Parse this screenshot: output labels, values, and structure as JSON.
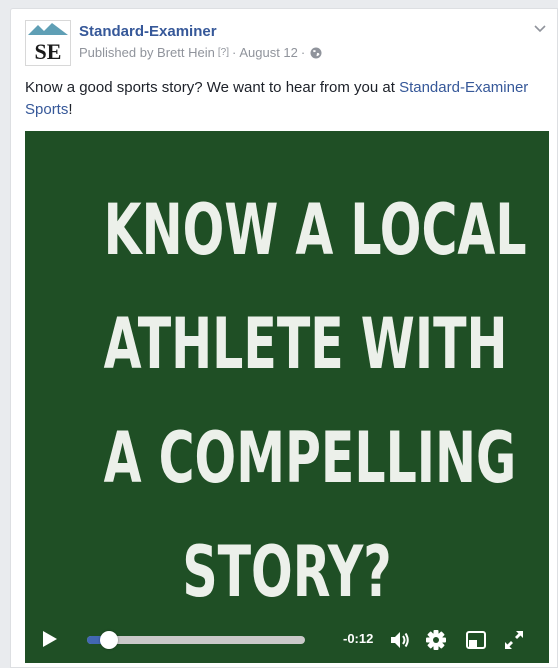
{
  "post": {
    "author": "Standard-Examiner",
    "avatar_text": "SE",
    "published_by": "Published by Brett Hein",
    "help_marker": "[?]",
    "separator": "·",
    "date": "August 12",
    "text_before_link": "Know a good sports story? We want to hear from you at ",
    "link_text": "Standard-Examiner Sports",
    "text_after_link": "!"
  },
  "video": {
    "background_color": "#1f4f25",
    "overlay_lines": [
      "KNOW A LOCAL",
      "ATHLETE WITH",
      "A COMPELLING",
      "STORY?"
    ],
    "time_remaining": "-0:12",
    "progress_fraction": 0.1,
    "accent_color": "#4267b2"
  },
  "icons": {
    "avatar_mountain": "mountain-logo-icon",
    "privacy": "globe-icon",
    "menu": "chevron-down-icon",
    "play": "play-icon",
    "volume": "volume-icon",
    "settings": "gear-icon",
    "pip": "picture-in-picture-icon",
    "fullscreen": "fullscreen-icon"
  }
}
